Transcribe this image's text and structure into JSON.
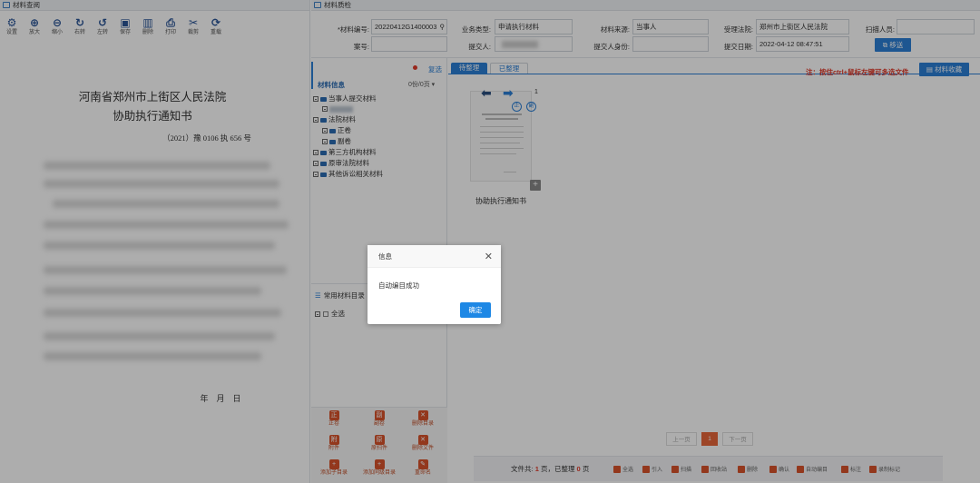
{
  "left_panel": {
    "title": "材料查阅",
    "toolbar": [
      {
        "label": "设置",
        "icon": "gear-icon",
        "glyph": "⚙"
      },
      {
        "label": "放大",
        "icon": "zoom-in-icon",
        "glyph": "⊕"
      },
      {
        "label": "缩小",
        "icon": "zoom-out-icon",
        "glyph": "⊖"
      },
      {
        "label": "右转",
        "icon": "rotate-right-icon",
        "glyph": "↻"
      },
      {
        "label": "左转",
        "icon": "rotate-left-icon",
        "glyph": "↺"
      },
      {
        "label": "保存",
        "icon": "save-icon",
        "glyph": "▣"
      },
      {
        "label": "删除",
        "icon": "trash-icon",
        "glyph": "▥"
      },
      {
        "label": "打印",
        "icon": "print-icon",
        "glyph": "⎙"
      },
      {
        "label": "裁剪",
        "icon": "crop-icon",
        "glyph": "✂"
      },
      {
        "label": "重载",
        "icon": "reload-icon",
        "glyph": "⟳"
      }
    ],
    "document": {
      "court": "河南省郑州市上街区人民法院",
      "title": "协助执行通知书",
      "case_no": "（2021）豫 0106 执 656 号",
      "date_line": "年    月    日"
    }
  },
  "right_panel": {
    "title": "材料质检",
    "form": {
      "material_no_label": "*材料编号:",
      "material_no_value": "20220412G1400003",
      "business_type_label": "业务类型:",
      "business_type_value": "申请执行材料",
      "source_label": "材料来源:",
      "source_value": "当事人",
      "court_label": "受理法院:",
      "court_value": "郑州市上街区人民法院",
      "scanner_label": "扫描人员:",
      "scanner_value": "",
      "case_label": "案号:",
      "case_value": "",
      "submitter_label": "提交人:",
      "submitter_value": "",
      "identity_label": "提交人身份:",
      "identity_value": "",
      "submit_date_label": "提交日期:",
      "submit_date_value": "2022-04-12 08:47:51",
      "transfer_button": "移送"
    },
    "tree": {
      "select_all": "复选",
      "header_label": "材料信息",
      "page_count": "0份/0页",
      "items": [
        "当事人提交材料",
        "",
        "法院材料",
        "正卷",
        "副卷",
        "第三方机构材料",
        "原审法院材料",
        "其他诉讼相关材料"
      ],
      "common_dir": "常用材料目录",
      "common_select_all": "全选"
    },
    "tabs": {
      "pending": "待整理",
      "done": "已整理"
    },
    "hint": "注：按住ctrl+鼠标左键可多选文件",
    "collect_button": "材料收藏",
    "thumbnail": {
      "page_num": "1",
      "caption": "协助执行通知书"
    },
    "bottom_buttons": [
      {
        "label": "正卷"
      },
      {
        "label": "副卷"
      },
      {
        "label": "删除目录"
      },
      {
        "label": "附件"
      },
      {
        "label": "原扫件"
      },
      {
        "label": "删除文件"
      },
      {
        "label": "添加子目录"
      },
      {
        "label": "添加同级目录"
      },
      {
        "label": "重命名"
      }
    ],
    "pagination": {
      "prev": "上一页",
      "current": "1",
      "next": "下一页"
    },
    "footer": {
      "file_total_prefix": "文件共:",
      "file_total_pages": "1",
      "file_total_mid": "页，已整理",
      "done_pages": "0",
      "done_suffix": "页",
      "actions": [
        "全选",
        "引入",
        "扫描",
        "回收站",
        "删除",
        "确认",
        "自动编目",
        "标注",
        "录制标记"
      ]
    }
  },
  "modal": {
    "title": "信息",
    "message": "自动编目成功",
    "ok": "确定"
  },
  "colors": {
    "accent": "#2b7fd6",
    "warning": "#e03a2a",
    "action": "#d9532c"
  }
}
